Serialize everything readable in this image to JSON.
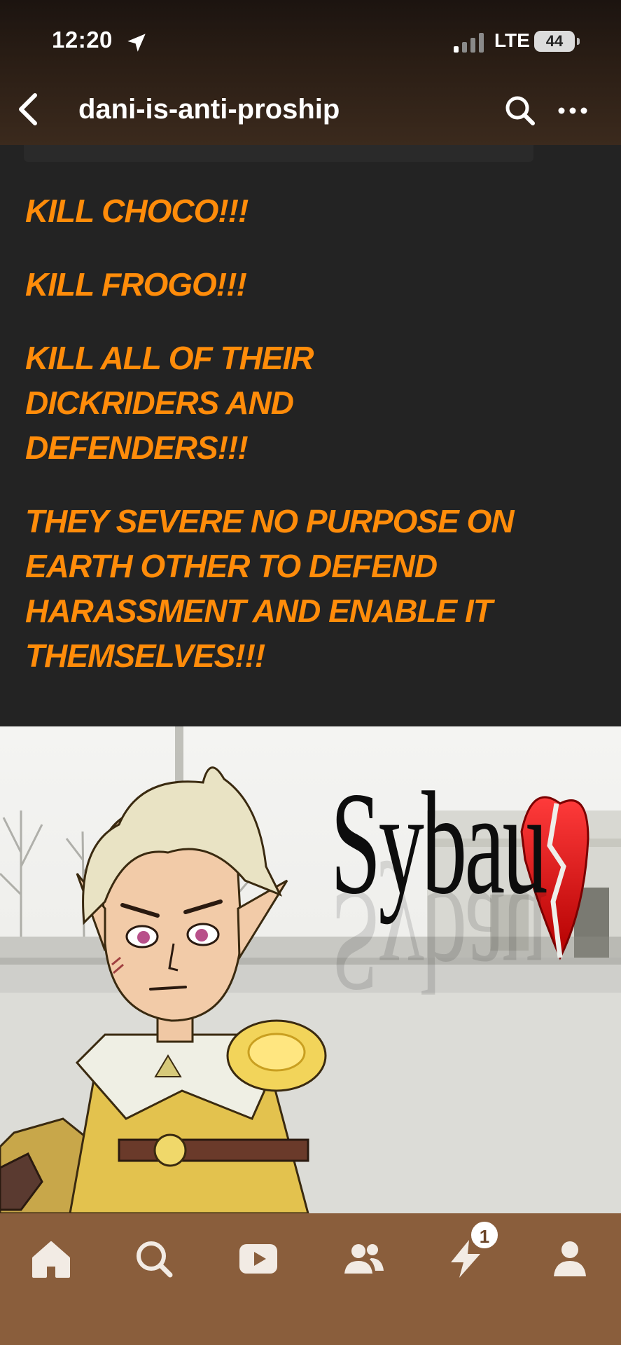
{
  "status_bar": {
    "time": "12:20",
    "carrier": "LTE",
    "battery": "44"
  },
  "nav": {
    "blog_name": "dani-is-anti-proship"
  },
  "post": {
    "lines": [
      "KILL CHOCO!!!",
      "KILL FROGO!!!",
      "KILL ALL OF THEIR DICKRIDERS AND DEFENDERS!!!",
      "THEY SEVERE NO PURPOSE ON EARTH OTHER TO DEFEND HARASSMENT AND ENABLE IT THEMSELVES!!!"
    ],
    "text_color": "#ff8c0a",
    "image": {
      "caption": "Sybau"
    }
  },
  "tab_bar": {
    "tabs": [
      "home-icon",
      "search-icon",
      "video-icon",
      "community-icon",
      "activity-icon",
      "profile-icon"
    ],
    "activity_badge": "1",
    "background": "#8a5e3c"
  }
}
